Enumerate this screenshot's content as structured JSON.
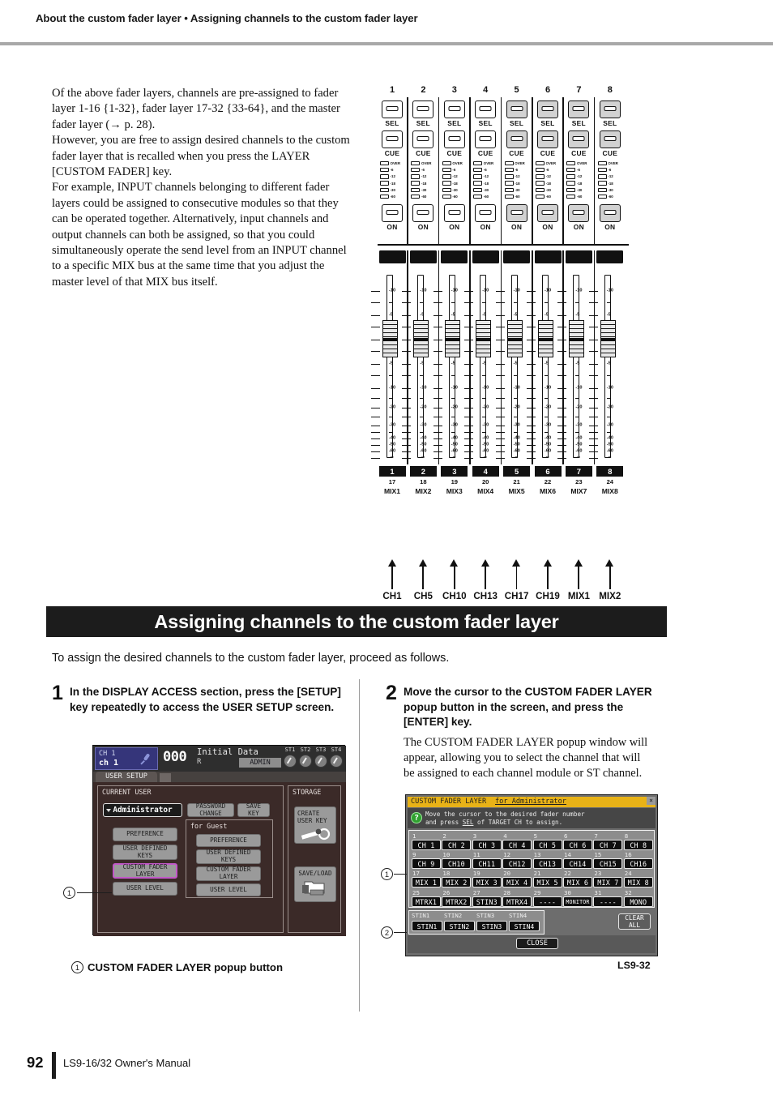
{
  "running_head": "About the custom fader layer • Assigning channels to the custom fader layer",
  "intro": {
    "p1": "Of the above fader layers, channels are pre-assigned to fader layer 1-16 {1-32}, fader layer 17-32 {33-64}, and the master fader layer (→ p. 28).",
    "p2": "However, you are free to assign desired channels to the custom fader layer that is recalled when you press the LAYER [CUSTOM FADER] key.",
    "p3": "For example, INPUT channels belonging to different fader layers could be assigned to consecutive modules so that they can be operated together. Alternatively, input channels and output channels can both be assigned, so that you could simultaneously operate the send level from an INPUT channel to a specific MIX bus at the same time that you adjust the master level of that MIX bus itself."
  },
  "mixer_diagram": {
    "column_numbers": [
      "1",
      "2",
      "3",
      "4",
      "5",
      "6",
      "7",
      "8"
    ],
    "sel_label": "SEL",
    "cue_label": "CUE",
    "on_label": "ON",
    "meter_labels": [
      "OVER",
      "-6",
      "-12",
      "-18",
      "-30",
      "-60"
    ],
    "fader_scale": [
      "10",
      "5",
      "0",
      "5",
      "10",
      "20",
      "30",
      "40",
      "50",
      "60",
      "∞"
    ],
    "module_numbers": [
      "1",
      "2",
      "3",
      "4",
      "5",
      "6",
      "7",
      "8"
    ],
    "module_sub": [
      "17",
      "18",
      "19",
      "20",
      "21",
      "22",
      "23",
      "24"
    ],
    "module_names": [
      "MIX1",
      "MIX2",
      "MIX3",
      "MIX4",
      "MIX5",
      "MIX6",
      "MIX7",
      "MIX8"
    ],
    "arrow_labels": [
      "CH1",
      "CH5",
      "CH10",
      "CH13",
      "CH17",
      "CH19",
      "MIX1",
      "MIX2"
    ]
  },
  "section": {
    "banner": "Assigning channels to the custom fader layer",
    "lead": "To assign the desired channels to the custom fader layer, proceed as follows."
  },
  "steps": [
    {
      "number": "1",
      "text": "In the DISPLAY ACCESS section, press the [SETUP] key repeatedly to access the USER SETUP screen."
    },
    {
      "number": "2",
      "text": "Move the cursor to the CUSTOM FADER LAYER popup button in the screen, and press the [ENTER] key.",
      "sub": "The CUSTOM FADER LAYER popup window will appear, allowing you to select the channel that will be assigned to each channel module or ST channel."
    }
  ],
  "user_setup_screen": {
    "header": {
      "channel_upper": "CH 1",
      "channel_lower": "ch 1",
      "scene_number": "000",
      "scene_name": "Initial Data",
      "scene_r": "R",
      "admin_badge": "ADMIN",
      "st_knobs": [
        "ST1",
        "ST2",
        "ST3",
        "ST4"
      ]
    },
    "tab": "USER SETUP",
    "current_user": {
      "title": "CURRENT USER",
      "user_name": "Administrator",
      "password_change": "PASSWORD\nCHANGE",
      "save_key": "SAVE\nKEY",
      "buttons": [
        "PREFERENCE",
        "USER DEFINED\nKEYS",
        "CUSTOM FADER\nLAYER",
        "USER LEVEL"
      ]
    },
    "guest": {
      "title": "for Guest",
      "buttons": [
        "PREFERENCE",
        "USER DEFINED\nKEYS",
        "CUSTOM FADER\nLAYER",
        "USER LEVEL"
      ]
    },
    "storage": {
      "title": "STORAGE",
      "create_user_key": "CREATE\nUSER KEY",
      "save_load": "SAVE/LOAD"
    }
  },
  "callout_caption": {
    "marker": "1",
    "text": "CUSTOM FADER LAYER popup button"
  },
  "popup": {
    "title": "CUSTOM FADER LAYER",
    "title_owner": "for Administrator",
    "close_x": "×",
    "help_icon": "?",
    "help_line1": "Move the cursor to the desired fader number",
    "help_line2_a": "and press ",
    "help_line2_b": "SEL",
    "help_line2_c": " of TARGET CH to assign.",
    "grid": [
      {
        "num": "1",
        "label": "CH 1"
      },
      {
        "num": "2",
        "label": "CH 2"
      },
      {
        "num": "3",
        "label": "CH 3"
      },
      {
        "num": "4",
        "label": "CH 4"
      },
      {
        "num": "5",
        "label": "CH 5"
      },
      {
        "num": "6",
        "label": "CH 6"
      },
      {
        "num": "7",
        "label": "CH 7"
      },
      {
        "num": "8",
        "label": "CH 8"
      },
      {
        "num": "9",
        "label": "CH 9"
      },
      {
        "num": "10",
        "label": "CH10"
      },
      {
        "num": "11",
        "label": "CH11"
      },
      {
        "num": "12",
        "label": "CH12"
      },
      {
        "num": "13",
        "label": "CH13"
      },
      {
        "num": "14",
        "label": "CH14"
      },
      {
        "num": "15",
        "label": "CH15"
      },
      {
        "num": "16",
        "label": "CH16"
      },
      {
        "num": "17",
        "label": "MIX 1"
      },
      {
        "num": "18",
        "label": "MIX 2"
      },
      {
        "num": "19",
        "label": "MIX 3"
      },
      {
        "num": "20",
        "label": "MIX 4"
      },
      {
        "num": "21",
        "label": "MIX 5"
      },
      {
        "num": "22",
        "label": "MIX 6"
      },
      {
        "num": "23",
        "label": "MIX 7"
      },
      {
        "num": "24",
        "label": "MIX 8"
      },
      {
        "num": "25",
        "label": "MTRX1"
      },
      {
        "num": "26",
        "label": "MTRX2"
      },
      {
        "num": "27",
        "label": "STIN3"
      },
      {
        "num": "28",
        "label": "MTRX4"
      },
      {
        "num": "29",
        "label": "----"
      },
      {
        "num": "30",
        "label": "MONITOR"
      },
      {
        "num": "31",
        "label": "----"
      },
      {
        "num": "32",
        "label": "MONO"
      }
    ],
    "stin_labels": [
      "STIN1",
      "STIN2",
      "STIN3",
      "STIN4"
    ],
    "stin_buttons": [
      "STIN1",
      "STIN2",
      "STIN3",
      "STIN4"
    ],
    "clear_all": "CLEAR\nALL",
    "close": "CLOSE",
    "model_caption": "LS9-32",
    "callouts": [
      "1",
      "2"
    ]
  },
  "footer": {
    "page_number": "92",
    "manual_title": "LS9-16/32  Owner's Manual"
  },
  "colors": {
    "banner_bg": "#1c1c1c",
    "lcd_bg": "#3b2a28",
    "popup_title": "#e8b217",
    "highlight": "#c258c8",
    "channel_block": "#35357a",
    "help_green": "#2fa02f"
  }
}
